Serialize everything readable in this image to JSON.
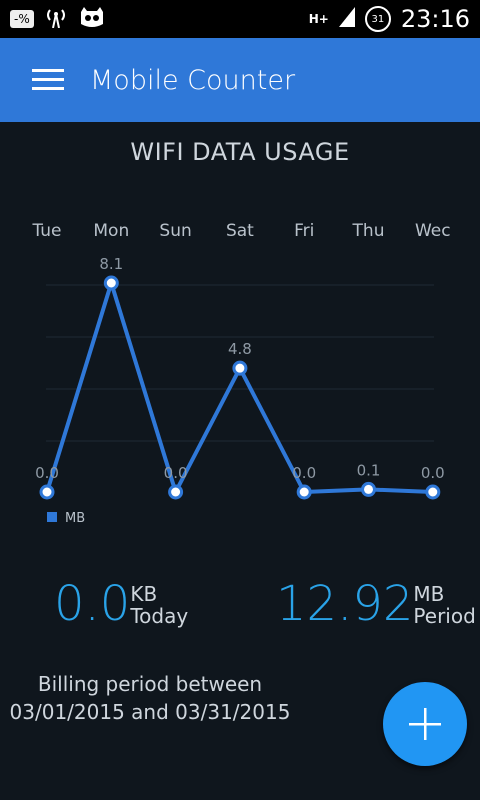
{
  "status_bar": {
    "left_badge": "-%",
    "network": "H+",
    "battery_level": "31",
    "time": "23:16"
  },
  "app_bar": {
    "title": "Mobile Counter"
  },
  "chart_title": "WIFI DATA USAGE",
  "chart_data": {
    "type": "line",
    "categories": [
      "Tue",
      "Mon",
      "Sun",
      "Sat",
      "Fri",
      "Thu",
      "Wec"
    ],
    "series": [
      {
        "name": "MB",
        "values": [
          0.0,
          8.1,
          0.0,
          4.8,
          0.0,
          0.1,
          0.0
        ],
        "labels": [
          "0.0",
          "8.1",
          "0.0",
          "4.8",
          "0.0",
          "0.1",
          "0.0"
        ]
      }
    ],
    "ylim": [
      0,
      8.1
    ],
    "grid": true,
    "legend": "bottom-left",
    "color": "#2f78d8"
  },
  "stats": {
    "today_value": "0.0",
    "today_unit": "KB",
    "today_label": "Today",
    "period_value": "12.92",
    "period_unit": "MB",
    "period_label": "Period"
  },
  "billing": {
    "line1": "Billing period between",
    "line2": "03/01/2015 and 03/31/2015"
  },
  "fab_icon": "plus-icon"
}
